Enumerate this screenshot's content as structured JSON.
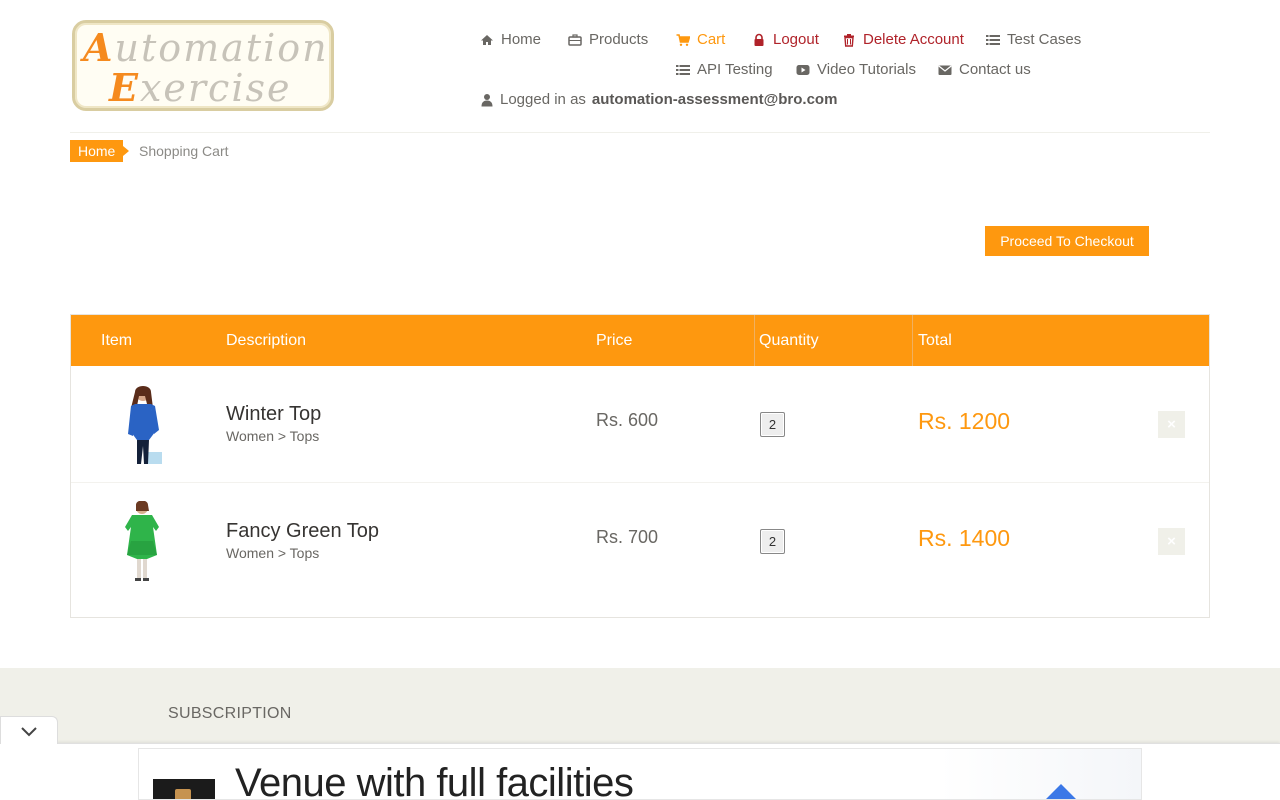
{
  "logo": {
    "line1_cap": "A",
    "line1_rest": "utomation",
    "line2_cap": "E",
    "line2_rest": "xercise"
  },
  "nav": {
    "home": "Home",
    "products": "Products",
    "cart": "Cart",
    "logout": "Logout",
    "delete_account": "Delete Account",
    "test_cases": "Test Cases",
    "api_testing": "API Testing",
    "video_tutorials": "Video Tutorials",
    "contact_us": "Contact us"
  },
  "logged_in": {
    "prefix": "Logged in as",
    "user": "automation-assessment@bro.com"
  },
  "breadcrumb": {
    "home": "Home",
    "current": "Shopping Cart"
  },
  "checkout_button": "Proceed To Checkout",
  "cart": {
    "columns": [
      "Item",
      "Description",
      "Price",
      "Quantity",
      "Total"
    ],
    "items": [
      {
        "name": "Winter Top",
        "category": "Women > Tops",
        "price": "Rs. 600",
        "quantity": "2",
        "total": "Rs. 1200",
        "delete": "×"
      },
      {
        "name": "Fancy Green Top",
        "category": "Women > Tops",
        "price": "Rs. 700",
        "quantity": "2",
        "total": "Rs. 1400",
        "delete": "×"
      }
    ]
  },
  "footer": {
    "subscription_title": "SUBSCRIPTION"
  },
  "ad": {
    "headline": "Venue with full facilities"
  },
  "colors": {
    "accent": "#fe980f",
    "danger": "#b0232a",
    "text": "#696763",
    "footer_bg": "#f0f0e9"
  },
  "icons": [
    "home-icon",
    "briefcase-icon",
    "cart-icon",
    "lock-icon",
    "trash-icon",
    "list-icon",
    "video-icon",
    "envelope-icon",
    "user-icon",
    "chevron-down-icon"
  ]
}
